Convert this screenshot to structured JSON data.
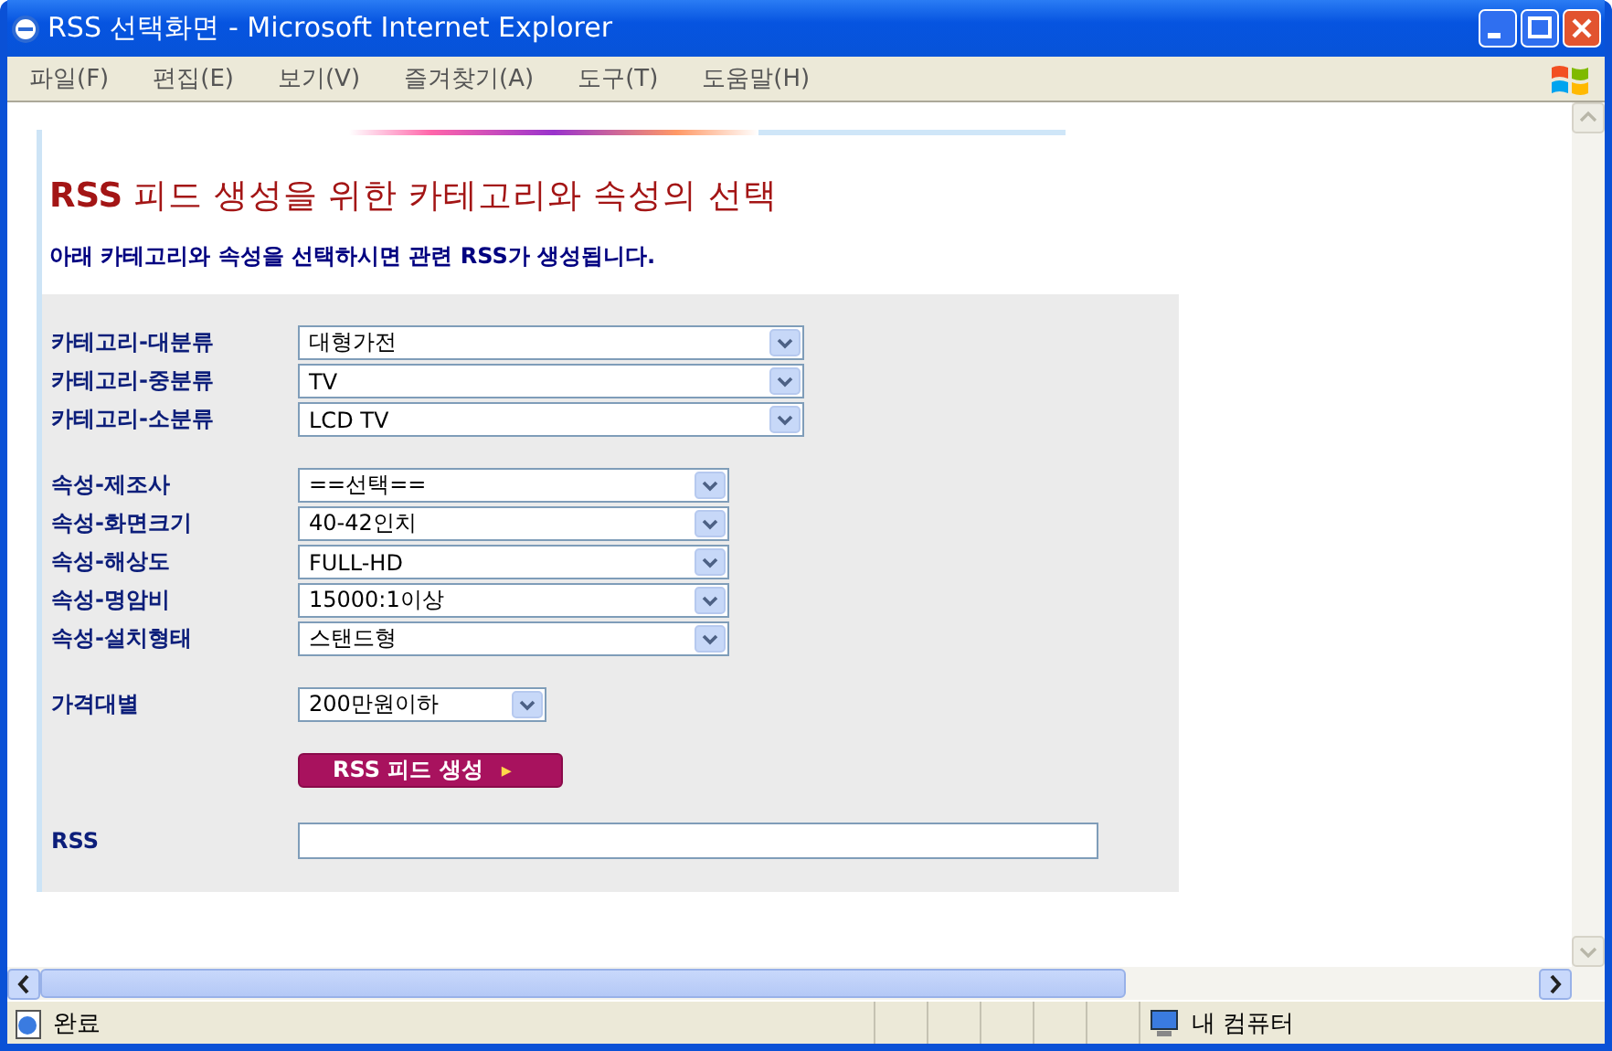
{
  "window": {
    "title": "RSS 선택화면 - Microsoft Internet Explorer"
  },
  "menu": [
    "파일(F)",
    "편집(E)",
    "보기(V)",
    "즐겨찾기(A)",
    "도구(T)",
    "도움말(H)"
  ],
  "page": {
    "heading": "**RSS** 피드 생성을 위한 카테고리와 속성의 선택",
    "subtitle": "아래 카테고리와 속성을 선택하시면 관련 RSS가 생성됩니다."
  },
  "groups": [
    {
      "kind": "wide",
      "fields": [
        {
          "label": "카테고리-대분류",
          "value": "대형가전"
        },
        {
          "label": "카테고리-중분류",
          "value": "TV"
        },
        {
          "label": "카테고리-소분류",
          "value": "LCD TV"
        }
      ]
    },
    {
      "kind": "medium",
      "fields": [
        {
          "label": "속성-제조사",
          "value": "==선택=="
        },
        {
          "label": "속성-화면크기",
          "value": "40-42인치"
        },
        {
          "label": "속성-해상도",
          "value": "FULL-HD"
        },
        {
          "label": "속성-명암비",
          "value": "15000:1이상"
        },
        {
          "label": "속성-설치형태",
          "value": "스탠드형"
        }
      ]
    },
    {
      "kind": "narrow",
      "fields": [
        {
          "label": "가격대별",
          "value": "200만원이하"
        }
      ]
    }
  ],
  "button": {
    "label": "RSS 피드 생성",
    "icon": "▸"
  },
  "rss": {
    "label": "RSS"
  },
  "status_bar": {
    "text": "완료",
    "zone": "내 컴퓨터"
  }
}
